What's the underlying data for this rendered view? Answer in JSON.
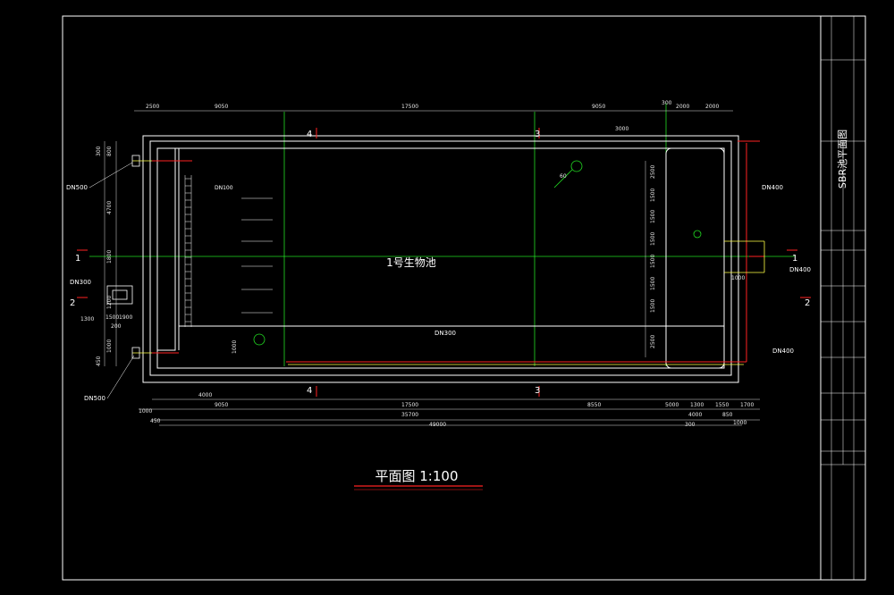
{
  "drawing": {
    "title": "平面图  1:100",
    "pool_name": "1号生物池",
    "sheet_title": "SBR池平面图"
  },
  "dims_top": {
    "d1": "2500",
    "d2": "9050",
    "d3": "17500",
    "d4": "9050",
    "d5": "300",
    "d6": "2000",
    "d7": "2000",
    "d8": "3000"
  },
  "dims_bottom": {
    "b1": "4000",
    "b2": "9050",
    "b3": "17500",
    "b4": "8550",
    "b5": "5000",
    "b6": "1300",
    "b7": "1700",
    "b8": "4000",
    "b9": "1550",
    "c1": "1000",
    "c2": "35700",
    "c3": "300",
    "c4": "850",
    "c5": "1000",
    "c6": "49000",
    "c7": "450"
  },
  "dims_left": {
    "l1": "300",
    "l2": "800",
    "l3": "4700",
    "l4": "1800",
    "l5": "1200",
    "l6": "1300",
    "l7": "1900",
    "l8": "1500",
    "l9": "200",
    "l10": "1000",
    "l11": "450",
    "l12": "1000"
  },
  "dims_right": {
    "r1": "2500",
    "r2": "1500",
    "r3": "1500",
    "r4": "1500",
    "r5": "1500",
    "r6": "1500",
    "r7": "1500",
    "r8": "2500",
    "r9": "1000"
  },
  "section_marks": {
    "s1": "1",
    "s2": "2",
    "s3": "3",
    "s4": "4"
  },
  "pipes": {
    "p_dn500_top": "DN500",
    "p_dn100": "DN100",
    "p_dn300_left": "DN300",
    "p_dn500_bottom": "DN500",
    "p_dn400_top_right": "DN400",
    "p_dn400_mid_right": "DN400",
    "p_dn400_bottom_right": "DN400",
    "p_dn300_bottom": "DN300"
  },
  "misc": {
    "angle": "60"
  },
  "colors": {
    "line_white": "#ffffff",
    "line_green": "#22dd22",
    "line_red": "#ff2222",
    "line_yellow": "#ffff44",
    "frame": "#ffffff"
  }
}
